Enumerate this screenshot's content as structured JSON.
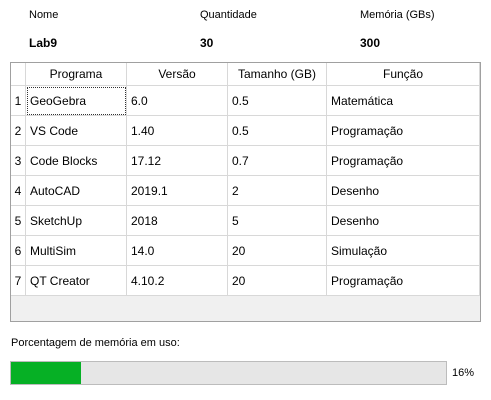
{
  "header": {
    "col1_label": "Nome",
    "col2_label": "Quantidade",
    "col3_label": "Memória (GBs)",
    "name": "Lab9",
    "quantity": "30",
    "memory": "300"
  },
  "table": {
    "columns": [
      "Programa",
      "Versão",
      "Tamanho (GB)",
      "Função"
    ],
    "rows": [
      {
        "n": "1",
        "programa": "GeoGebra",
        "versao": "6.0",
        "tamanho": "0.5",
        "funcao": "Matemática"
      },
      {
        "n": "2",
        "programa": "VS Code",
        "versao": "1.40",
        "tamanho": "0.5",
        "funcao": "Programação"
      },
      {
        "n": "3",
        "programa": "Code Blocks",
        "versao": "17.12",
        "tamanho": "0.7",
        "funcao": "Programação"
      },
      {
        "n": "4",
        "programa": "AutoCAD",
        "versao": "2019.1",
        "tamanho": "2",
        "funcao": "Desenho"
      },
      {
        "n": "5",
        "programa": "SketchUp",
        "versao": "2018",
        "tamanho": "5",
        "funcao": "Desenho"
      },
      {
        "n": "6",
        "programa": "MultiSim",
        "versao": "14.0",
        "tamanho": "20",
        "funcao": "Simulação"
      },
      {
        "n": "7",
        "programa": "QT Creator",
        "versao": "4.10.2",
        "tamanho": "20",
        "funcao": "Programação"
      }
    ]
  },
  "memory_usage": {
    "label": "Porcentagem de memória em uso:",
    "percent": 16,
    "percent_text": "16%",
    "fill_color": "#06b025"
  }
}
